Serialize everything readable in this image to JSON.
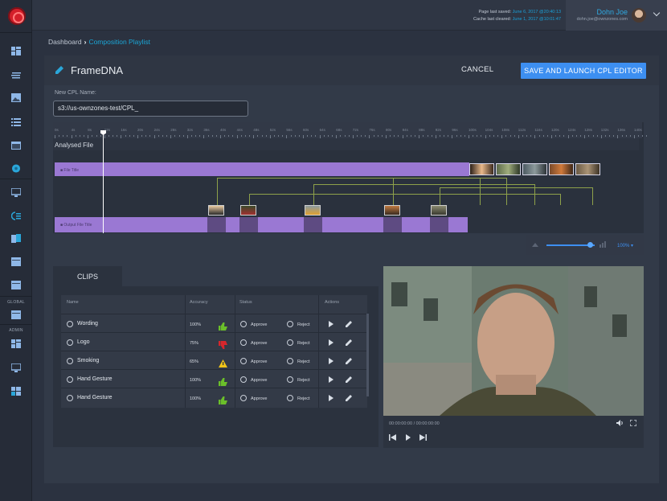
{
  "header": {
    "saved_label": "Page last saved:",
    "saved_value": "June 6, 2017 @20:40:13",
    "cleared_label": "Cache last cleared:",
    "cleared_value": "June 1, 2017 @10:01:47",
    "user_name": "Dohn Joe",
    "user_email": "dohn.joe@ownzones.com"
  },
  "sidebar": {
    "global_label": "GLOBAL",
    "admin_label": "ADMIN"
  },
  "breadcrumb": {
    "home": "Dashboard",
    "current": "Composition Playlist"
  },
  "page": {
    "title": "FrameDNA",
    "cancel_label": "CANCEL",
    "launch_label": "SAVE AND LAUNCH CPL EDITOR",
    "cpl_label": "New CPL Name:",
    "cpl_value": "s3://us-ownzones-test/CPL_"
  },
  "timeline": {
    "analysed_label": "Analysed File",
    "file_title": "File Title",
    "output_title": "Output File Title",
    "zoom": "100%",
    "ticks": [
      "0s",
      "4s",
      "8s",
      "12s",
      "16s",
      "20s",
      "24s",
      "28s",
      "32s",
      "36s",
      "40s",
      "44s",
      "48s",
      "52s",
      "56s",
      "60s",
      "64s",
      "68s",
      "72s",
      "76s",
      "80s",
      "84s",
      "88s",
      "92s",
      "96s",
      "100s",
      "104s",
      "108s",
      "112s",
      "116s",
      "120s",
      "124s",
      "128s",
      "132s",
      "136s",
      "140s"
    ]
  },
  "clips": {
    "tab_label": "CLIPS",
    "columns": [
      "Name",
      "Accuracy",
      "Status",
      "Actions"
    ],
    "approve_label": "Approve",
    "reject_label": "Reject",
    "rows": [
      {
        "name": "Wording",
        "accuracy": "100%",
        "icon": "thumbs-up-icon",
        "color": "#6bbf2a"
      },
      {
        "name": "Logo",
        "accuracy": "75%",
        "icon": "thumbs-down-icon",
        "color": "#d7262c"
      },
      {
        "name": "Smoking",
        "accuracy": "65%",
        "icon": "warning-icon",
        "color": "#f0c419"
      },
      {
        "name": "Hand Gesture",
        "accuracy": "100%",
        "icon": "thumbs-up-icon",
        "color": "#6bbf2a"
      },
      {
        "name": "Hand Gesture",
        "accuracy": "100%",
        "icon": "thumbs-up-icon",
        "color": "#6bbf2a"
      }
    ]
  },
  "player": {
    "time": "00:00:00:00 / 00:00:00:00"
  },
  "colors": {
    "accent": "#3d8ff1",
    "link": "#1aa6d6",
    "track": "#9a78d3"
  }
}
